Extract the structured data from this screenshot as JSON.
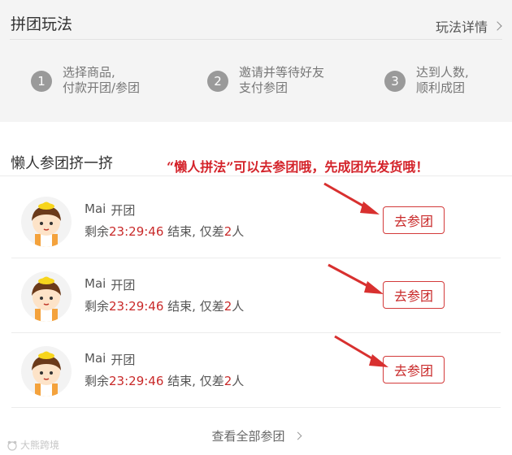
{
  "rules": {
    "title": "拼团玩法",
    "details_link": "玩法详情",
    "steps": [
      {
        "num": "1",
        "line1": "选择商品,",
        "line2": "付款开团/参团"
      },
      {
        "num": "2",
        "line1": "邀请并等待好友",
        "line2": "支付参团"
      },
      {
        "num": "3",
        "line1": "达到人数,",
        "line2": "顺利成团"
      }
    ]
  },
  "lazy": {
    "title": "懒人参团挤一挤",
    "banner": "“懒人拼法”可以去参团哦，先成团先发货哦！"
  },
  "groups": [
    {
      "name": "Mai",
      "action": "开团",
      "prefix": "剩余",
      "time": "23:29:46",
      "middle": " 结束, 仅差",
      "count": "2",
      "suffix": "人",
      "button": "去参团"
    },
    {
      "name": "Mai",
      "action": "开团",
      "prefix": "剩余",
      "time": "23:29:46",
      "middle": " 结束, 仅差",
      "count": "2",
      "suffix": "人",
      "button": "去参团"
    },
    {
      "name": "Mai",
      "action": "开团",
      "prefix": "剩余",
      "time": "23:29:46",
      "middle": " 结束, 仅差",
      "count": "2",
      "suffix": "人",
      "button": "去参团"
    }
  ],
  "footer": {
    "view_all": "查看全部参团",
    "watermark": "大熊跨境"
  },
  "colors": {
    "accent": "#d4232a",
    "arrow": "#d8302f",
    "step_badge": "#9a9a9a"
  },
  "icons": {
    "chevron": "chevron-right-icon",
    "avatar": "cartoon-boy-avatar"
  }
}
